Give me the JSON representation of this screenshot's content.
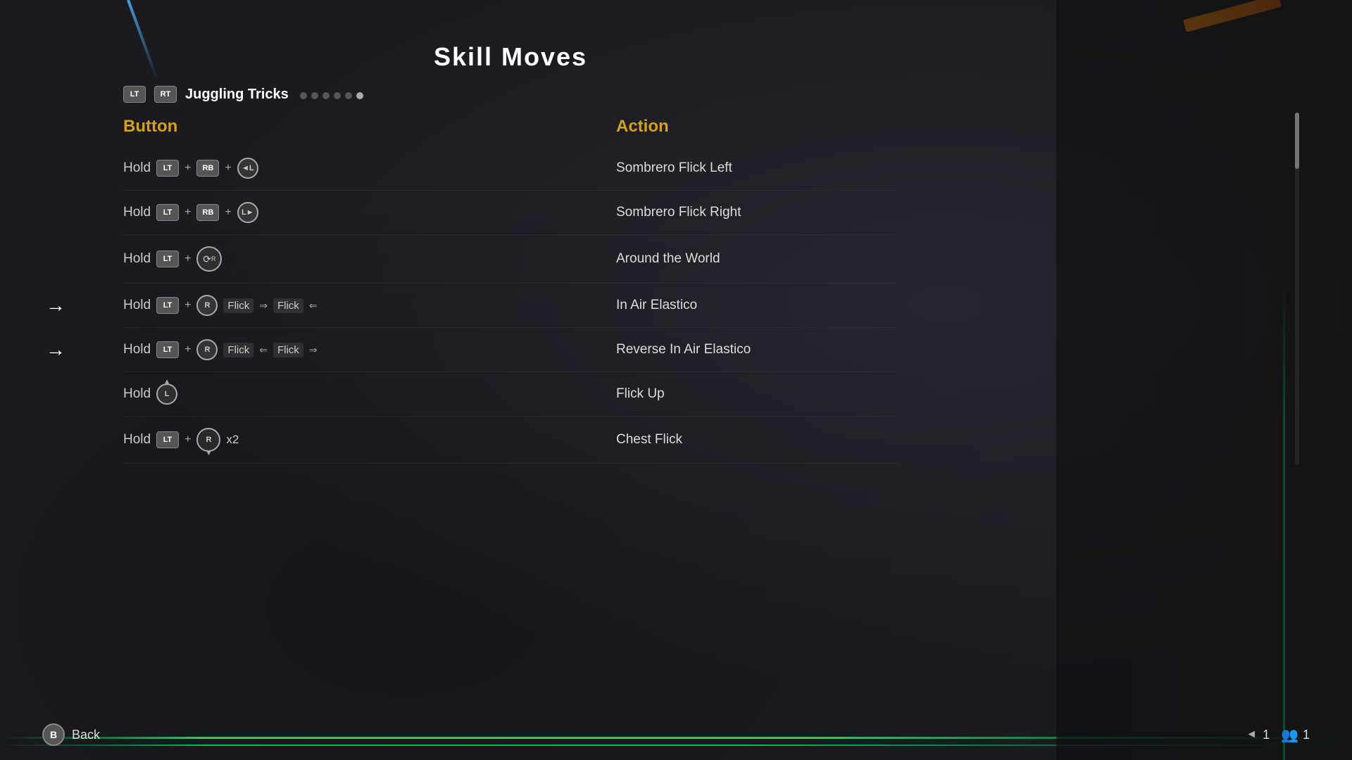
{
  "page": {
    "title": "Skill Moves",
    "category": {
      "lt_label": "LT",
      "rt_label": "RT",
      "name": "Juggling Tricks",
      "dots": [
        {
          "active": false
        },
        {
          "active": false
        },
        {
          "active": false
        },
        {
          "active": false
        },
        {
          "active": false
        },
        {
          "active": true
        }
      ]
    },
    "columns": {
      "button_header": "Button",
      "action_header": "Action"
    },
    "moves": [
      {
        "id": 1,
        "button_parts": [
          "Hold",
          "LT",
          "+",
          "RB",
          "+",
          "L←"
        ],
        "action": "Sombrero Flick Left",
        "has_arrow": false
      },
      {
        "id": 2,
        "button_parts": [
          "Hold",
          "LT",
          "+",
          "RB",
          "+",
          "L→"
        ],
        "action": "Sombrero Flick Right",
        "has_arrow": false
      },
      {
        "id": 3,
        "button_parts": [
          "Hold",
          "LT",
          "+",
          "R↻"
        ],
        "action": "Around the World",
        "has_arrow": false
      },
      {
        "id": 4,
        "button_parts": [
          "Hold",
          "LT",
          "+",
          "R",
          "Flick",
          "→",
          "Flick",
          "←"
        ],
        "action": "In Air Elastico",
        "has_arrow": true
      },
      {
        "id": 5,
        "button_parts": [
          "Hold",
          "LT",
          "+",
          "R",
          "Flick",
          "←",
          "Flick",
          "→"
        ],
        "action": "Reverse In Air Elastico",
        "has_arrow": true
      },
      {
        "id": 6,
        "button_parts": [
          "Hold",
          "L↑"
        ],
        "action": "Flick Up",
        "has_arrow": false
      },
      {
        "id": 7,
        "button_parts": [
          "Hold",
          "LT",
          "+",
          "R↓",
          "x2"
        ],
        "action": "Chest Flick",
        "has_arrow": false
      }
    ],
    "bottom": {
      "back_label": "Back",
      "b_label": "B",
      "page_number": "1",
      "player_count": "1"
    }
  }
}
